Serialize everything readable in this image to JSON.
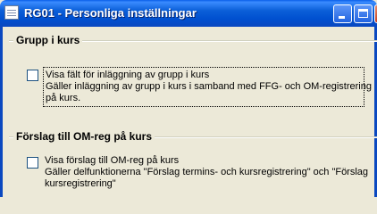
{
  "window": {
    "title": "RG01 - Personliga inställningar",
    "buttons": [
      "minimize",
      "maximize",
      "close"
    ]
  },
  "groups": [
    {
      "title": "Grupp i kurs",
      "checkbox_checked": false,
      "label": "Visa fält för inläggning av grupp i kurs",
      "desc_line1": "Gäller inläggning av grupp i kurs i samband med FFG- och OM-registrering",
      "desc_line2": "på kurs."
    },
    {
      "title": "Förslag till OM-reg på kurs",
      "checkbox_checked": false,
      "label": "Visa förslag till OM-reg på kurs",
      "desc_line1": "Gäller delfunktionerna \"Förslag termins- och kursregistrering\" och \"Förslag",
      "desc_line2": "kursregistrering\""
    }
  ]
}
